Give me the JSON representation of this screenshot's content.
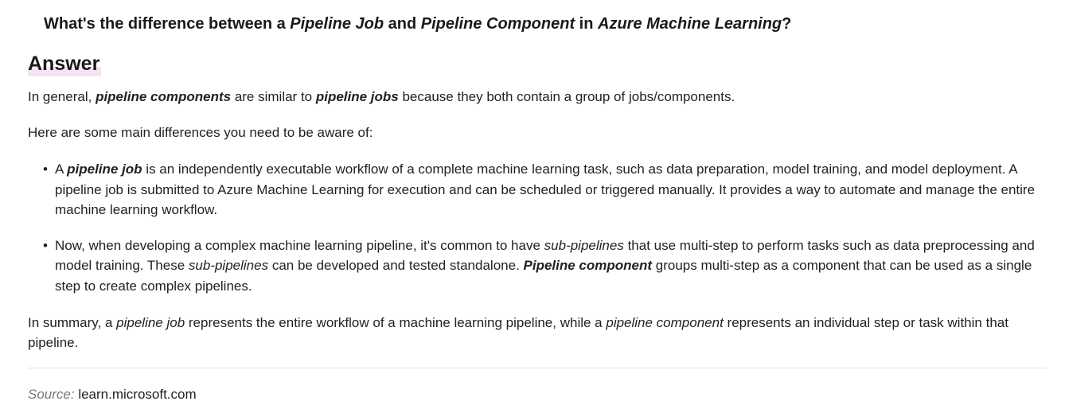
{
  "question": {
    "t1": "What's the difference between a ",
    "t2": "Pipeline Job",
    "t3": " and ",
    "t4": "Pipeline Component",
    "t5": " in ",
    "t6": "Azure Machine Learning",
    "t7": "?"
  },
  "answer_heading": "Answer",
  "para1": {
    "t1": "In general, ",
    "t2": "pipeline components",
    "t3": " are similar to ",
    "t4": "pipeline jobs",
    "t5": " because they both contain a group of jobs/components."
  },
  "para2": "Here are some main differences you need to be aware of:",
  "bullet1": {
    "t1": "A ",
    "t2": "pipeline job",
    "t3": " is an independently executable workflow of a complete machine learning task, such as data preparation, model training, and model deployment. A pipeline job is submitted to Azure Machine Learning for execution and can be scheduled or triggered manually. It provides a way to automate and manage the entire machine learning workflow."
  },
  "bullet2": {
    "t1": "Now, when developing a complex machine learning pipeline, it's common to have ",
    "t2": "sub-pipelines",
    "t3": " that use multi-step to perform tasks such as data preprocessing and model training. These ",
    "t4": "sub-pipelines",
    "t5": " can be developed and tested standalone. ",
    "t6": "Pipeline component",
    "t7": " groups multi-step as a component that can be used as a single step to create complex pipelines."
  },
  "summary": {
    "t1": "In summary, a ",
    "t2": "pipeline job",
    "t3": " represents the entire workflow of a machine learning pipeline, while a ",
    "t4": "pipeline component",
    "t5": " represents an individual step or task within that pipeline."
  },
  "source": {
    "label": "Source:",
    "domain": "learn.microsoft.com"
  },
  "bullet_glyph": "•"
}
